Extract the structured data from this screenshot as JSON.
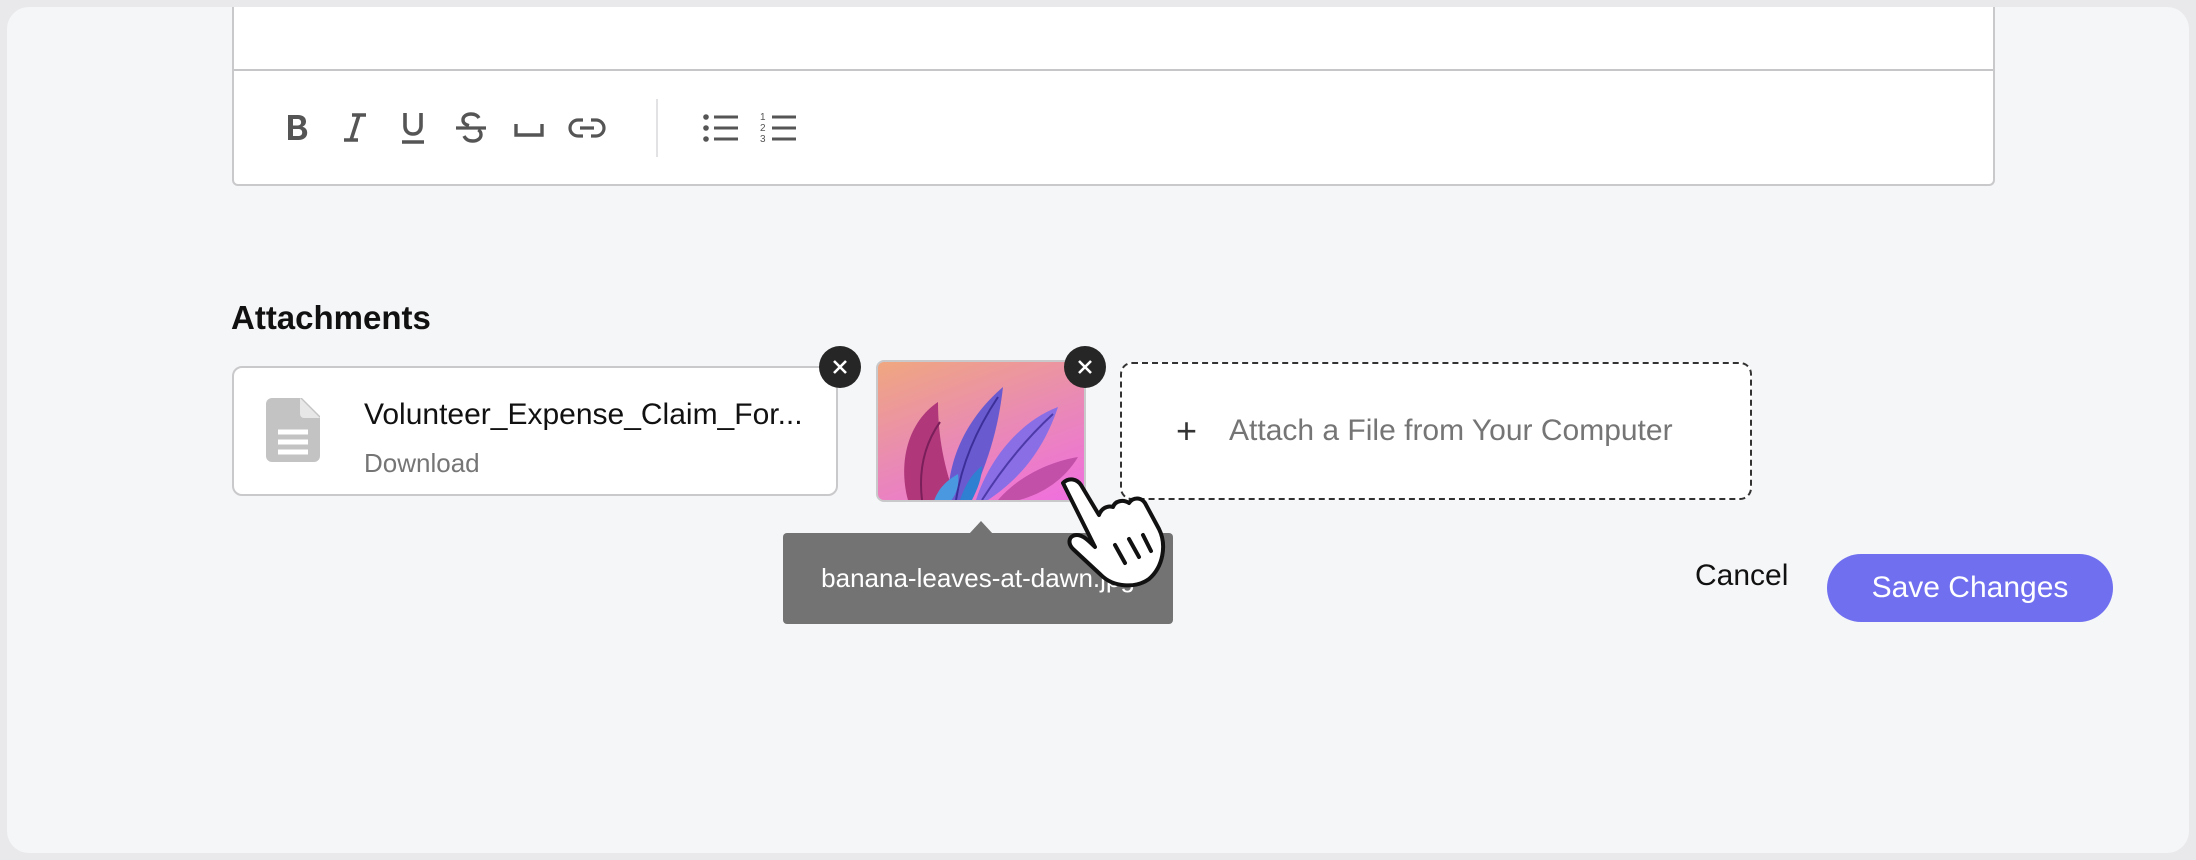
{
  "toolbar": {
    "buttons": [
      "bold-icon",
      "italic-icon",
      "underline-icon",
      "strikethrough-icon",
      "space-icon",
      "link-icon"
    ],
    "list_buttons": [
      "bulleted-list-icon",
      "numbered-list-icon"
    ]
  },
  "attachments": {
    "title": "Attachments",
    "file": {
      "name": "Volunteer_Expense_Claim_For...",
      "action": "Download",
      "icon": "document-icon"
    },
    "image": {
      "tooltip": "banana-leaves-at-dawn.jpg"
    },
    "dropzone": {
      "icon": "plus-icon",
      "label": "Attach a File from Your Computer"
    }
  },
  "actions": {
    "cancel": "Cancel",
    "save": "Save Changes"
  },
  "colors": {
    "primary": "#6f6ff0",
    "remove_button": "#262626",
    "tooltip_bg": "#737373",
    "background": "#f5f6f8"
  }
}
